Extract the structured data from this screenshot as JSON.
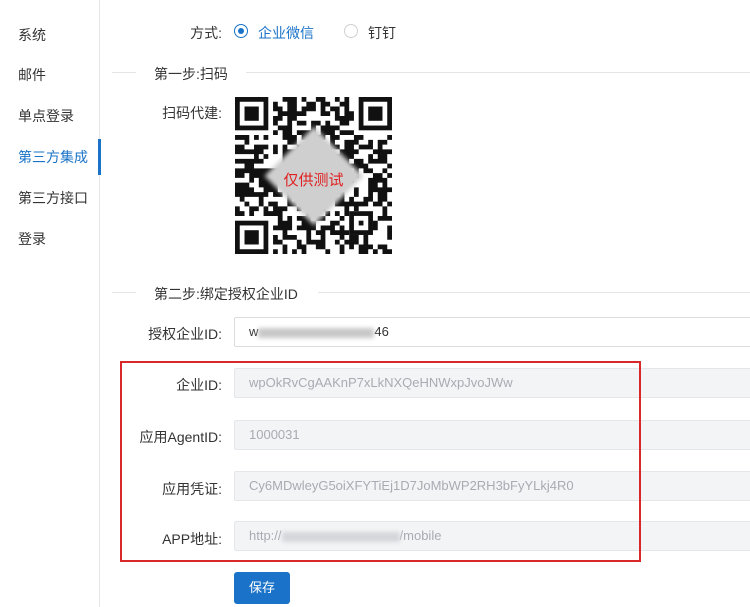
{
  "sidebar": {
    "items": [
      {
        "label": "系统"
      },
      {
        "label": "邮件"
      },
      {
        "label": "单点登录"
      },
      {
        "label": "第三方集成",
        "active": true
      },
      {
        "label": "第三方接口"
      },
      {
        "label": "登录"
      }
    ]
  },
  "method": {
    "label": "方式:",
    "options": [
      {
        "label": "企业微信",
        "selected": true
      },
      {
        "label": "钉钉",
        "selected": false
      }
    ]
  },
  "step1": {
    "title": "第一步:扫码",
    "qr_label": "扫码代建:",
    "qr_overlay_text": "仅供测试"
  },
  "step2": {
    "title": "第二步:绑定授权企业ID",
    "auth_corp_id": {
      "label": "授权企业ID:",
      "value_prefix": "w",
      "value_suffix": "46"
    },
    "corp_id": {
      "label": "企业ID:",
      "value": "wpOkRvCgAAKnP7xLkNXQeHNWxpJvoJWw"
    },
    "agent_id": {
      "label": "应用AgentID:",
      "value": "1000031"
    },
    "credential": {
      "label": "应用凭证:",
      "value": "Cy6MDwleyG5oiXFYTiEj1D7JoMbWP2RH3bFyYLkj4R0"
    },
    "app_url": {
      "label": "APP地址:",
      "value_prefix": "http://",
      "value_suffix": "/mobile"
    }
  },
  "actions": {
    "save_label": "保存"
  },
  "colors": {
    "accent": "#1a73c8",
    "highlight_box": "#d8282a",
    "overlay_text": "#e02020"
  }
}
